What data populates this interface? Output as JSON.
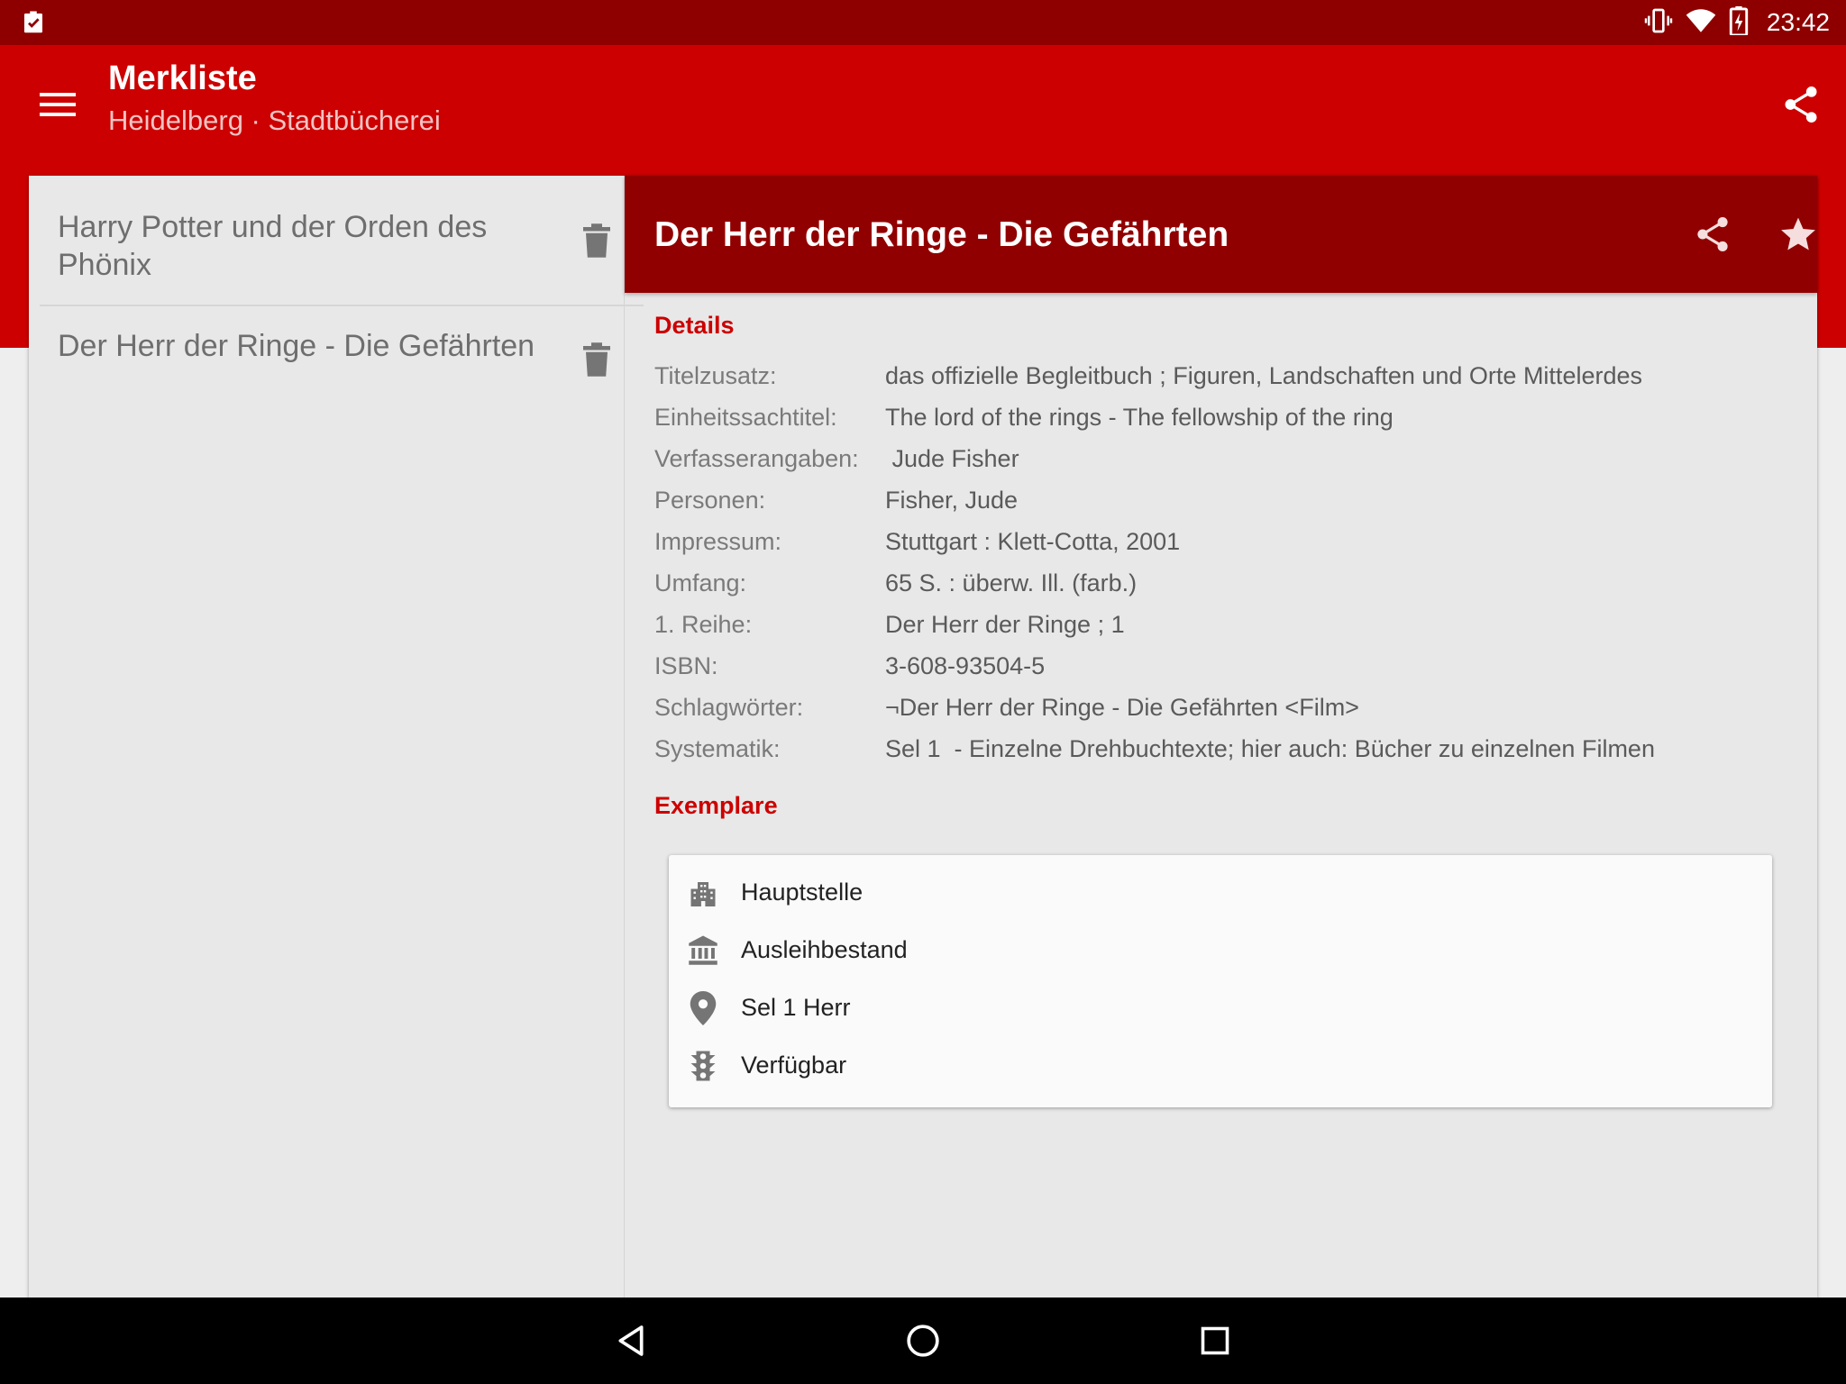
{
  "status_bar": {
    "time": "23:42",
    "icons": [
      "clipboard-check-icon",
      "vibrate-icon",
      "wifi-icon",
      "battery-charging-icon"
    ]
  },
  "app_bar": {
    "title": "Merkliste",
    "subtitle": "Heidelberg · Stadtbücherei",
    "icons": [
      "menu-icon",
      "share-icon"
    ]
  },
  "list": {
    "items": [
      {
        "title": "Harry Potter und der Orden des Phönix",
        "icon": "trash-icon"
      },
      {
        "title": "Der Herr der Ringe - Die Gefährten",
        "icon": "trash-icon"
      }
    ]
  },
  "detail": {
    "title": "Der Herr der Ringe - Die Gefährten",
    "header_icons": [
      "share-icon",
      "star-icon"
    ],
    "details_heading": "Details",
    "fields": [
      {
        "label": "Titelzusatz:",
        "value": "das offizielle Begleitbuch ; Figuren, Landschaften und Orte Mittelerdes"
      },
      {
        "label": "Einheitssachtitel:",
        "value": "The lord of the rings - The fellowship of the ring"
      },
      {
        "label": "Verfasserangaben:",
        "value": " Jude Fisher"
      },
      {
        "label": "Personen:",
        "value": "Fisher, Jude"
      },
      {
        "label": "Impressum:",
        "value": "Stuttgart : Klett-Cotta, 2001"
      },
      {
        "label": "Umfang:",
        "value": "65 S. : überw. Ill. (farb.)"
      },
      {
        "label": "1. Reihe:",
        "value": "Der Herr der Ringe ; 1"
      },
      {
        "label": "ISBN:",
        "value": "3-608-93504-5"
      },
      {
        "label": "Schlagwörter:",
        "value": "¬Der Herr der Ringe - Die Gefährten <Film>"
      },
      {
        "label": "Systematik:",
        "value": "Sel 1  - Einzelne Drehbuchtexte; hier auch: Bücher zu einzelnen Filmen"
      }
    ],
    "copies_heading": "Exemplare",
    "copy": [
      {
        "icon": "building-icon",
        "text": "Hauptstelle"
      },
      {
        "icon": "bank-icon",
        "text": "Ausleihbestand"
      },
      {
        "icon": "location-pin-icon",
        "text": "Sel 1 Herr"
      },
      {
        "icon": "traffic-light-icon",
        "text": "Verfügbar"
      }
    ]
  },
  "nav_bar": {
    "icons": [
      "back-icon",
      "home-icon",
      "recents-icon"
    ]
  },
  "colors": {
    "status_bar": "#8e0000",
    "app_bar": "#cc0000",
    "detail_header": "#910000",
    "accent_text": "#cc0000"
  }
}
